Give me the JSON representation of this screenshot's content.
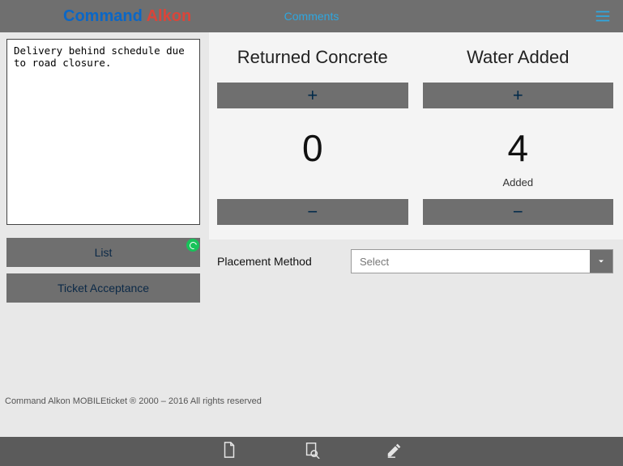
{
  "header": {
    "brand_a": "Command ",
    "brand_b": "Alkon",
    "title": "Comments"
  },
  "comments": {
    "value": "Delivery behind schedule due to road closure."
  },
  "buttons": {
    "list": "List",
    "ticket_acceptance": "Ticket Acceptance"
  },
  "counters": [
    {
      "title": "Returned Concrete",
      "plus": "+",
      "minus": "−",
      "value": "0",
      "sub": ""
    },
    {
      "title": "Water Added",
      "plus": "+",
      "minus": "−",
      "value": "4",
      "sub": "Added"
    }
  ],
  "placement": {
    "label": "Placement Method",
    "selected": "Select"
  },
  "footer": "Command Alkon MOBILEticket ® 2000 – 2016 All rights reserved"
}
